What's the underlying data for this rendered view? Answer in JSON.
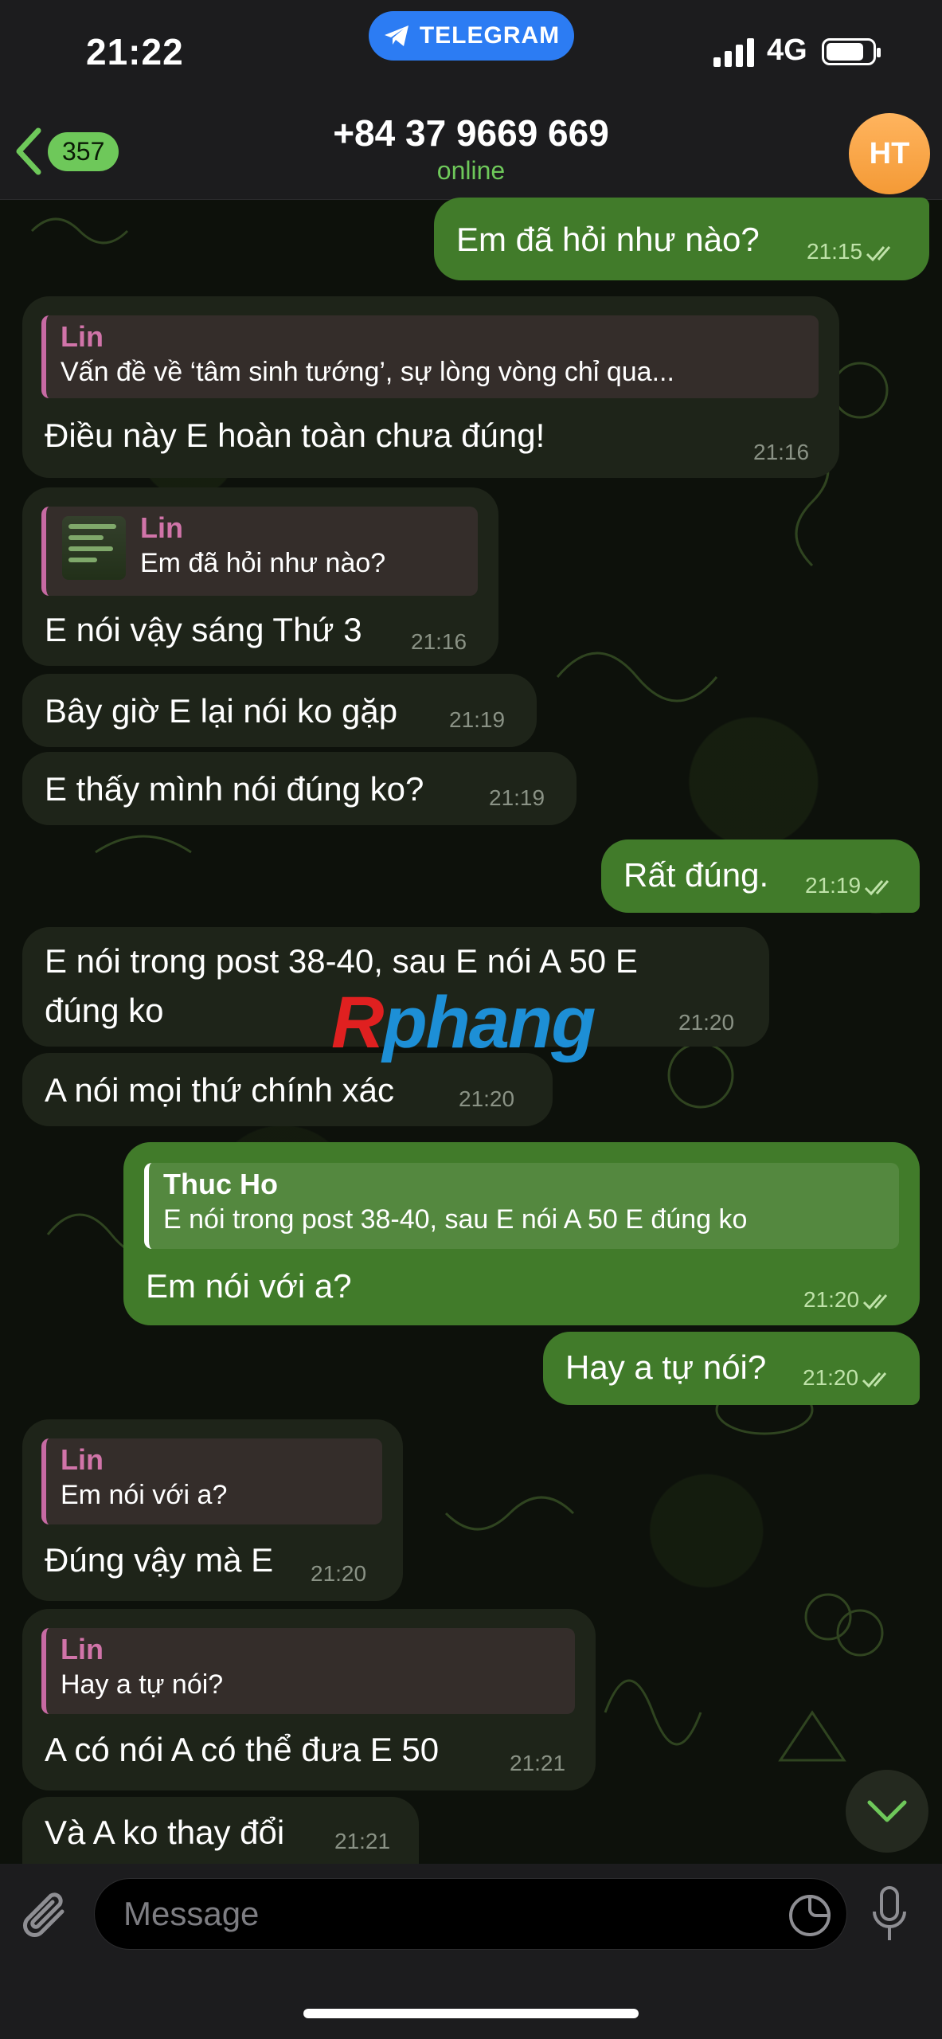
{
  "status_bar": {
    "time": "21:22",
    "app_pill": "TELEGRAM",
    "network": "4G"
  },
  "header": {
    "back_count": "357",
    "title": "+84 37 9669 669",
    "subtitle": "online",
    "avatar_initials": "HT"
  },
  "messages": [
    {
      "dir": "out",
      "text": "Em đã hỏi như nào?",
      "time": "21:15"
    },
    {
      "dir": "in",
      "reply": {
        "name": "Lin",
        "text": "Vấn đề về ‘tâm sinh tướng’, sự lòng vòng chỉ qua..."
      },
      "text": "Điều này E hoàn toàn chưa đúng!",
      "time": "21:16"
    },
    {
      "dir": "in",
      "reply": {
        "name": "Lin",
        "text": "Em đã hỏi như nào?"
      },
      "text": "E nói vậy sáng Thứ 3",
      "time": "21:16"
    },
    {
      "dir": "in",
      "text": "Bây giờ E lại nói ko gặp",
      "time": "21:19"
    },
    {
      "dir": "in",
      "text": "E thấy mình nói đúng ko?",
      "time": "21:19"
    },
    {
      "dir": "out",
      "text": "Rất đúng.",
      "time": "21:19"
    },
    {
      "dir": "in",
      "text_line1": "E nói trong post 38-40, sau E nói A 50 E",
      "text_line2": "đúng ko",
      "time": "21:20"
    },
    {
      "dir": "in",
      "text": "A nói mọi thứ chính xác",
      "time": "21:20"
    },
    {
      "dir": "out",
      "reply": {
        "name": "Thuc Ho",
        "text": "E nói trong post 38-40, sau E nói A 50 E đúng ko"
      },
      "text": "Em nói với a?",
      "time": "21:20"
    },
    {
      "dir": "out",
      "text": "Hay a tự nói?",
      "time": "21:20"
    },
    {
      "dir": "in",
      "reply": {
        "name": "Lin",
        "text": "Em nói với a?"
      },
      "text": "Đúng vậy mà E",
      "time": "21:20"
    },
    {
      "dir": "in",
      "reply": {
        "name": "Lin",
        "text": "Hay a tự nói?"
      },
      "text": "A có nói A có thể đưa E 50",
      "time": "21:21"
    },
    {
      "dir": "in",
      "text": "Và A ko thay đổi",
      "time": "21:21"
    }
  ],
  "watermark": {
    "part1": "R",
    "part2": "phang"
  },
  "composer": {
    "placeholder": "Message"
  },
  "icons": [
    "telegram-plane-icon",
    "signal-icon",
    "battery-icon",
    "back-chevron-icon",
    "double-check-icon",
    "scroll-down-chevron-icon",
    "paperclip-icon",
    "sticker-icon",
    "microphone-icon"
  ],
  "colors": {
    "outgoing_bubble": "#417b2a",
    "incoming_bubble": "#1e2419",
    "accent_green": "#6ec85a",
    "reply_name": "#d174a9",
    "telegram_blue": "#2c7cf3",
    "avatar_orange": "#f49a36"
  }
}
